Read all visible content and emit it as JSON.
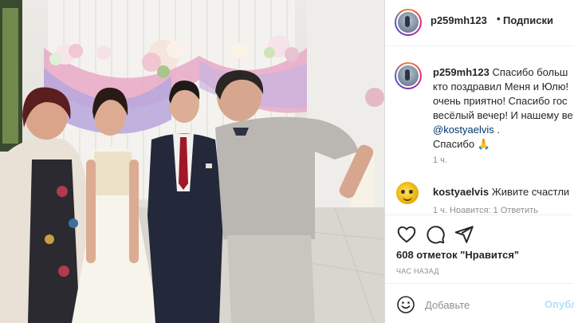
{
  "post": {
    "photo_description_icon": "wedding-photo"
  },
  "header": {
    "username": "p259mh123",
    "dot": "•",
    "follow_label": "Подписки"
  },
  "caption": {
    "username": "p259mh123",
    "lines": [
      "Спасибо больш",
      "кто поздравил Меня и Юлю!",
      "очень приятно! Спасибо гос",
      "весёлый вечер! И нашему ве",
      "@kostyaelvis .",
      "Спасибо 🙏"
    ],
    "time": "1 ч."
  },
  "comment": {
    "username": "kostyaelvis",
    "text": "Живите счастли",
    "meta": "1 ч.     Нравится: 1     Ответить"
  },
  "actions": {
    "like_icon": "heart-icon",
    "comment_icon": "comment-icon",
    "share_icon": "share-icon"
  },
  "likes": "608 отметок \"Нравится\"",
  "time_ago": "ЧАС НАЗАД",
  "add_comment": {
    "placeholder": "Добавьте",
    "publish_label": "Опубл"
  },
  "colors": {
    "mention": "#00376b",
    "publish": "#b2dffc",
    "muted": "#8e8e8e"
  }
}
